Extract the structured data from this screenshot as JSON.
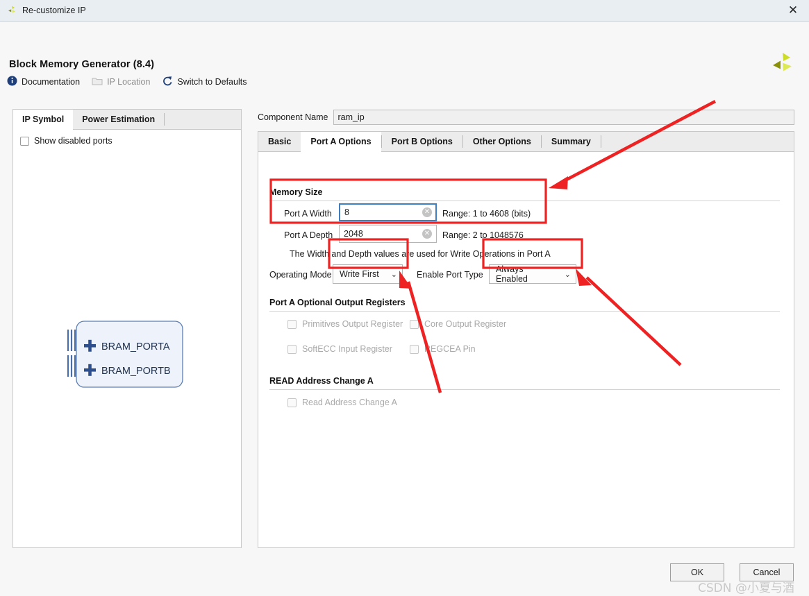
{
  "window": {
    "title": "Re-customize IP",
    "close_label": "✕",
    "app_icon": "vivado-logo-icon"
  },
  "header": {
    "app_title": "Block Memory Generator (8.4)",
    "vendor_logo": "amd-xilinx-logo-icon"
  },
  "links": [
    {
      "label": "Documentation",
      "icon": "info-icon",
      "disabled": false
    },
    {
      "label": "IP Location",
      "icon": "folder-icon",
      "disabled": true
    },
    {
      "label": "Switch to Defaults",
      "icon": "refresh-icon",
      "disabled": false
    }
  ],
  "left_panel": {
    "tabs": [
      {
        "label": "IP Symbol",
        "active": true
      },
      {
        "label": "Power Estimation",
        "active": false
      }
    ],
    "show_disabled_ports": {
      "label": "Show disabled ports",
      "checked": false
    },
    "ip_symbol": {
      "ports": [
        "BRAM_PORTA",
        "BRAM_PORTB"
      ],
      "expander": "+"
    }
  },
  "component_name": {
    "label": "Component Name",
    "value": "ram_ip"
  },
  "right_panel": {
    "tabs": [
      {
        "label": "Basic",
        "active": false
      },
      {
        "label": "Port A Options",
        "active": true
      },
      {
        "label": "Port B Options",
        "active": false
      },
      {
        "label": "Other Options",
        "active": false
      },
      {
        "label": "Summary",
        "active": false
      }
    ],
    "memory_size": {
      "section_title": "Memory Size",
      "port_a_width": {
        "label": "Port A Width",
        "value": "8",
        "range": "Range: 1 to 4608 (bits)",
        "focused": true,
        "clear_icon": "✕"
      },
      "port_a_depth": {
        "label": "Port A Depth",
        "value": "2048",
        "range": "Range: 2 to 1048576",
        "focused": false,
        "clear_icon": "✕"
      },
      "help_text": "The Width and Depth values are used for Write Operations in Port A"
    },
    "operating_mode": {
      "label": "Operating Mode",
      "value": "Write First",
      "chevron": "⌄"
    },
    "enable_port_type": {
      "label": "Enable Port Type",
      "value": "Always Enabled",
      "chevron": "⌄"
    },
    "optional_output_registers": {
      "section_title": "Port A Optional Output Registers",
      "checkboxes": [
        {
          "label": "Primitives Output Register",
          "checked": false,
          "disabled": true
        },
        {
          "label": "Core Output Register",
          "checked": false,
          "disabled": true
        },
        {
          "label": "SoftECC Input Register",
          "checked": false,
          "disabled": true
        },
        {
          "label": "REGCEA Pin",
          "checked": false,
          "disabled": true
        }
      ]
    },
    "read_address_change": {
      "section_title": "READ Address Change A",
      "checkbox": {
        "label": "Read Address Change A",
        "checked": false,
        "disabled": true
      }
    }
  },
  "footer": {
    "ok_label": "OK",
    "cancel_label": "Cancel"
  },
  "watermark": "CSDN @小夏与酒",
  "colors": {
    "annotation_red": "#ee2222",
    "titlebar_bg": "#e8eef2",
    "focus_blue": "#3f7fbf",
    "symbol_blue": "#3a5f9e",
    "logo_yellow": "#cddc28"
  }
}
